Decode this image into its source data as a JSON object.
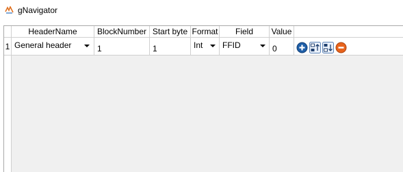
{
  "window": {
    "title": "gNavigator"
  },
  "table": {
    "columns": [
      "HeaderName",
      "BlockNumber",
      "Start byte",
      "Format",
      "Field",
      "Value"
    ],
    "rows": [
      {
        "row_number": "1",
        "header_name": "General header",
        "block_number": "1",
        "start_byte": "1",
        "format": "Int",
        "field": "FFID",
        "value": "0"
      }
    ],
    "row_actions": [
      "add-icon",
      "move-up-icon",
      "move-down-icon",
      "remove-icon"
    ]
  },
  "colors": {
    "add_button": "#1f5fa8",
    "remove_button": "#e8631c",
    "grid_background": "#f0f0f0"
  }
}
